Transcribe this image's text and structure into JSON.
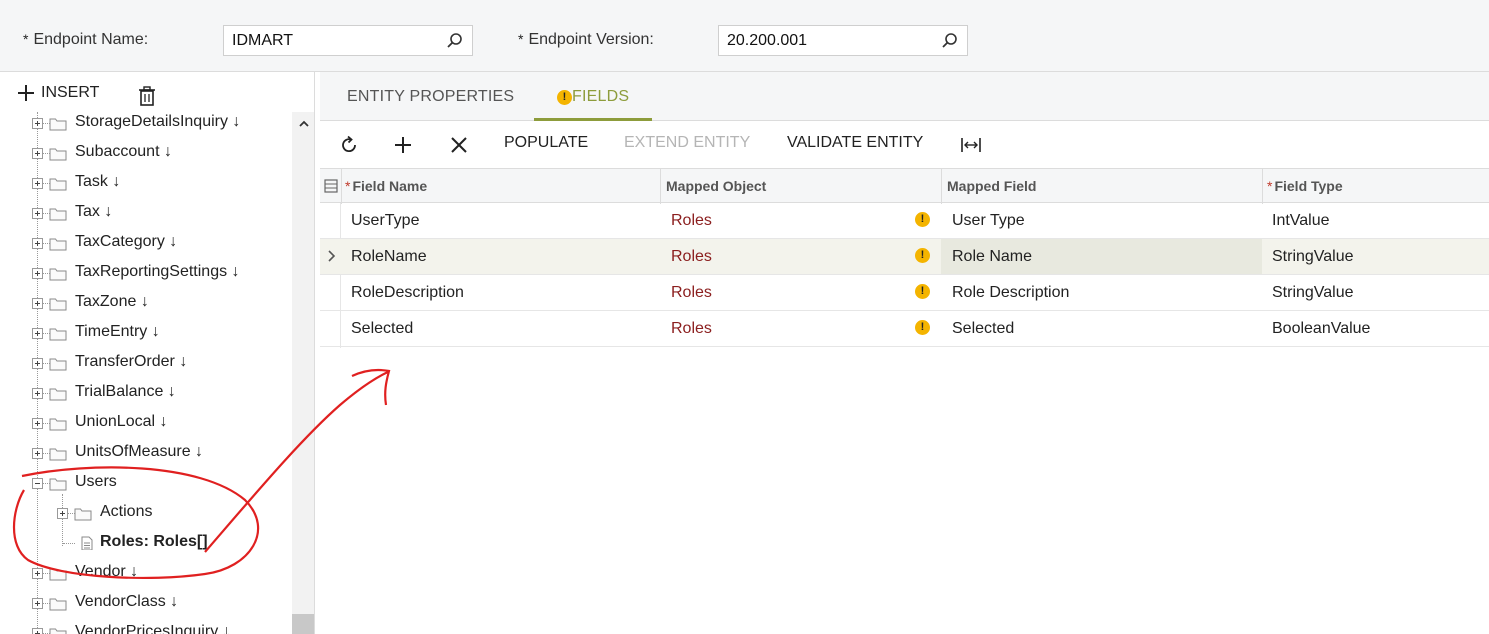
{
  "header": {
    "endpoint_name_label": "Endpoint Name:",
    "endpoint_name_value": "IDMART",
    "endpoint_version_label": "Endpoint Version:",
    "endpoint_version_value": "20.200.001",
    "required_mark": "*"
  },
  "left_toolbar": {
    "insert_label": "INSERT"
  },
  "tree": {
    "items": [
      {
        "label": "StorageDetailsInquiry ↓"
      },
      {
        "label": "Subaccount ↓"
      },
      {
        "label": "Task ↓"
      },
      {
        "label": "Tax ↓"
      },
      {
        "label": "TaxCategory ↓"
      },
      {
        "label": "TaxReportingSettings ↓"
      },
      {
        "label": "TaxZone ↓"
      },
      {
        "label": "TimeEntry ↓"
      },
      {
        "label": "TransferOrder ↓"
      },
      {
        "label": "TrialBalance ↓"
      },
      {
        "label": "UnionLocal ↓"
      },
      {
        "label": "UnitsOfMeasure ↓"
      },
      {
        "label": "Users"
      },
      {
        "label": "Actions"
      },
      {
        "label": "Roles: Roles[]"
      },
      {
        "label": "Vendor ↓"
      },
      {
        "label": "VendorClass ↓"
      },
      {
        "label": "VendorPricesInquiry ↓"
      }
    ]
  },
  "tabs": {
    "entity_properties": "ENTITY PROPERTIES",
    "fields": "FIELDS",
    "warn_glyph": "!"
  },
  "toolbar": {
    "populate": "POPULATE",
    "extend_entity": "EXTEND ENTITY",
    "validate_entity": "VALIDATE ENTITY"
  },
  "grid": {
    "columns": {
      "field_name": "Field Name",
      "mapped_object": "Mapped Object",
      "mapped_field": "Mapped Field",
      "field_type": "Field Type",
      "required_mark": "*"
    },
    "rows": [
      {
        "field_name": "UserType",
        "mapped_object": "Roles",
        "mapped_field": "User Type",
        "field_type": "IntValue"
      },
      {
        "field_name": "RoleName",
        "mapped_object": "Roles",
        "mapped_field": "Role Name",
        "field_type": "StringValue"
      },
      {
        "field_name": "RoleDescription",
        "mapped_object": "Roles",
        "mapped_field": "Role Description",
        "field_type": "StringValue"
      },
      {
        "field_name": "Selected",
        "mapped_object": "Roles",
        "mapped_field": "Selected",
        "field_type": "BooleanValue"
      }
    ]
  },
  "colors": {
    "accent": "#8d9c3b",
    "warning": "#f4b400",
    "mapped_object_text": "#8b1e1e",
    "annotation_ink": "#e02020"
  }
}
